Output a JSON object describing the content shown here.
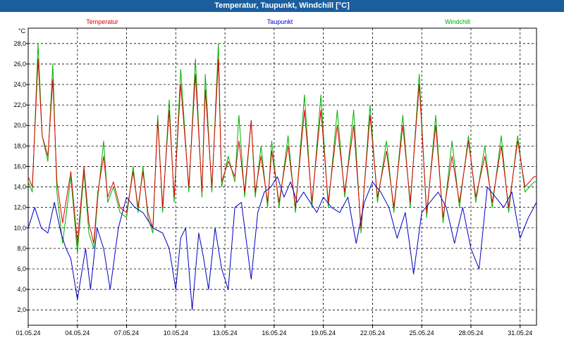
{
  "window": {
    "title": "Temperatur, Taupunkt, Windchill [°C]"
  },
  "chart_data": {
    "type": "line",
    "title": "Temperatur, Taupunkt, Windchill [°C]",
    "ylabel": "°C",
    "xlabel": "",
    "ylim": [
      0.5,
      29.5
    ],
    "y_ticks": [
      2.0,
      4.0,
      6.0,
      8.0,
      10.0,
      12.0,
      14.0,
      16.0,
      18.0,
      20.0,
      22.0,
      24.0,
      26.0,
      28.0
    ],
    "y_tick_labels": [
      "2,0",
      "4,0",
      "6,0",
      "8,0",
      "10,0",
      "12,0",
      "14,0",
      "16,0",
      "18,0",
      "20,0",
      "22,0",
      "24,0",
      "26,0",
      "28,0"
    ],
    "x_range_days": [
      1,
      32
    ],
    "x_tick_days": [
      1,
      4,
      7,
      10,
      13,
      16,
      19,
      22,
      25,
      28,
      31
    ],
    "x_tick_labels": [
      "01.05.24",
      "04.05.24",
      "07.05.24",
      "10.05.24",
      "13.05.24",
      "16.05.24",
      "19.05.24",
      "22.05.24",
      "25.05.24",
      "28.05.24",
      "31.05.24"
    ],
    "grid": true,
    "legend_placement": "top",
    "x_unit": "day of May 2024",
    "series": [
      {
        "name": "Temperatur",
        "color": "#e00000",
        "x": [
          1.0,
          1.25,
          1.6,
          1.85,
          2.2,
          2.5,
          2.75,
          3.1,
          3.6,
          4.0,
          4.4,
          4.7,
          5.0,
          5.25,
          5.6,
          5.85,
          6.2,
          6.6,
          7.0,
          7.4,
          7.7,
          8.0,
          8.3,
          8.6,
          8.9,
          9.2,
          9.6,
          9.9,
          10.3,
          10.8,
          11.2,
          11.6,
          11.8,
          12.2,
          12.6,
          12.8,
          13.2,
          13.6,
          13.85,
          14.2,
          14.6,
          14.85,
          15.2,
          15.6,
          15.85,
          16.3,
          16.85,
          17.3,
          17.85,
          18.3,
          18.85,
          19.3,
          19.85,
          20.3,
          20.85,
          21.3,
          21.85,
          22.3,
          22.85,
          23.3,
          23.85,
          24.3,
          24.85,
          25.3,
          25.85,
          26.3,
          26.85,
          27.3,
          27.85,
          28.3,
          28.85,
          29.3,
          29.85,
          30.3,
          30.85,
          31.3,
          31.85,
          32.0
        ],
        "y": [
          15.0,
          14.0,
          26.5,
          19.0,
          17.0,
          24.5,
          14.5,
          10.5,
          15.5,
          8.5,
          16.0,
          10.5,
          8.5,
          13.5,
          17.0,
          13.0,
          14.5,
          12.0,
          11.5,
          15.5,
          12.0,
          15.5,
          11.5,
          10.0,
          20.5,
          12.0,
          21.5,
          13.0,
          24.0,
          14.0,
          25.0,
          13.5,
          23.5,
          14.0,
          26.5,
          14.5,
          16.5,
          15.0,
          18.5,
          13.5,
          20.5,
          13.5,
          17.0,
          12.5,
          17.5,
          12.5,
          18.0,
          12.0,
          21.5,
          12.5,
          21.5,
          12.5,
          20.0,
          13.5,
          20.0,
          10.0,
          21.0,
          13.0,
          17.5,
          12.0,
          20.0,
          12.5,
          24.0,
          11.5,
          20.0,
          11.0,
          17.0,
          12.5,
          18.5,
          13.0,
          17.0,
          12.5,
          18.0,
          12.0,
          18.5,
          14.0,
          15.0,
          15.0
        ]
      },
      {
        "name": "Taupunkt",
        "color": "#0000c0",
        "x": [
          1.0,
          1.4,
          1.8,
          2.2,
          2.6,
          3.0,
          3.3,
          3.6,
          4.0,
          4.2,
          4.5,
          4.8,
          5.2,
          5.6,
          6.0,
          6.5,
          7.0,
          7.5,
          8.0,
          8.6,
          9.2,
          9.6,
          10.0,
          10.3,
          10.6,
          11.0,
          11.4,
          11.7,
          12.0,
          12.4,
          12.8,
          13.2,
          13.6,
          14.0,
          14.6,
          15.0,
          15.4,
          15.8,
          16.2,
          16.6,
          17.0,
          17.4,
          17.8,
          18.2,
          18.6,
          19.0,
          19.5,
          20.0,
          20.5,
          21.0,
          21.5,
          22.0,
          22.5,
          23.0,
          23.5,
          24.0,
          24.5,
          25.0,
          25.5,
          26.0,
          26.5,
          27.0,
          27.5,
          28.0,
          28.5,
          29.0,
          29.5,
          30.0,
          30.5,
          31.0,
          31.5,
          32.0
        ],
        "y": [
          10.0,
          12.0,
          10.0,
          9.5,
          12.5,
          9.5,
          8.0,
          7.0,
          3.0,
          5.0,
          8.0,
          4.0,
          10.0,
          8.0,
          4.0,
          10.0,
          13.0,
          12.0,
          11.5,
          10.0,
          9.5,
          8.0,
          4.0,
          9.0,
          10.0,
          2.0,
          9.5,
          7.0,
          4.0,
          10.0,
          6.0,
          4.0,
          12.0,
          12.5,
          5.0,
          11.5,
          13.5,
          14.0,
          15.0,
          13.0,
          14.5,
          12.5,
          13.5,
          12.5,
          11.5,
          13.0,
          12.0,
          11.5,
          13.0,
          8.5,
          12.5,
          14.5,
          13.5,
          12.0,
          9.0,
          11.5,
          5.5,
          11.5,
          12.5,
          13.5,
          12.0,
          8.5,
          12.0,
          8.0,
          6.0,
          14.0,
          13.0,
          12.0,
          13.5,
          9.0,
          11.0,
          12.5
        ]
      },
      {
        "name": "Windchill",
        "color": "#00b000",
        "x": [
          1.0,
          1.25,
          1.6,
          1.85,
          2.2,
          2.5,
          2.75,
          3.1,
          3.6,
          4.0,
          4.4,
          4.7,
          5.0,
          5.25,
          5.6,
          5.85,
          6.2,
          6.6,
          7.0,
          7.4,
          7.7,
          8.0,
          8.3,
          8.6,
          8.9,
          9.2,
          9.6,
          9.9,
          10.3,
          10.8,
          11.2,
          11.6,
          11.8,
          12.2,
          12.6,
          12.8,
          13.2,
          13.6,
          13.85,
          14.2,
          14.6,
          14.85,
          15.2,
          15.6,
          15.85,
          16.3,
          16.85,
          17.3,
          17.85,
          18.3,
          18.85,
          19.3,
          19.85,
          20.3,
          20.85,
          21.3,
          21.85,
          22.3,
          22.85,
          23.3,
          23.85,
          24.3,
          24.85,
          25.3,
          25.85,
          26.3,
          26.85,
          27.3,
          27.85,
          28.3,
          28.85,
          29.3,
          29.85,
          30.3,
          30.85,
          31.3,
          31.85,
          32.0
        ],
        "y": [
          14.5,
          13.5,
          28.0,
          19.0,
          16.5,
          26.0,
          13.5,
          8.5,
          15.0,
          7.5,
          15.5,
          9.5,
          8.0,
          13.0,
          18.5,
          12.5,
          14.0,
          11.5,
          11.0,
          16.0,
          11.5,
          16.0,
          11.0,
          9.5,
          21.0,
          11.5,
          22.5,
          12.5,
          25.5,
          13.5,
          26.5,
          13.0,
          25.0,
          13.5,
          28.0,
          14.0,
          17.0,
          14.5,
          21.0,
          13.0,
          20.5,
          13.0,
          18.0,
          12.0,
          18.5,
          12.0,
          19.0,
          11.5,
          23.0,
          12.0,
          23.0,
          12.0,
          21.5,
          13.0,
          21.5,
          9.5,
          22.0,
          12.5,
          18.5,
          11.5,
          21.0,
          12.0,
          25.0,
          11.0,
          21.0,
          10.5,
          18.5,
          12.0,
          19.0,
          12.5,
          18.0,
          12.0,
          19.0,
          11.5,
          19.0,
          13.5,
          14.5,
          14.5
        ]
      }
    ]
  }
}
